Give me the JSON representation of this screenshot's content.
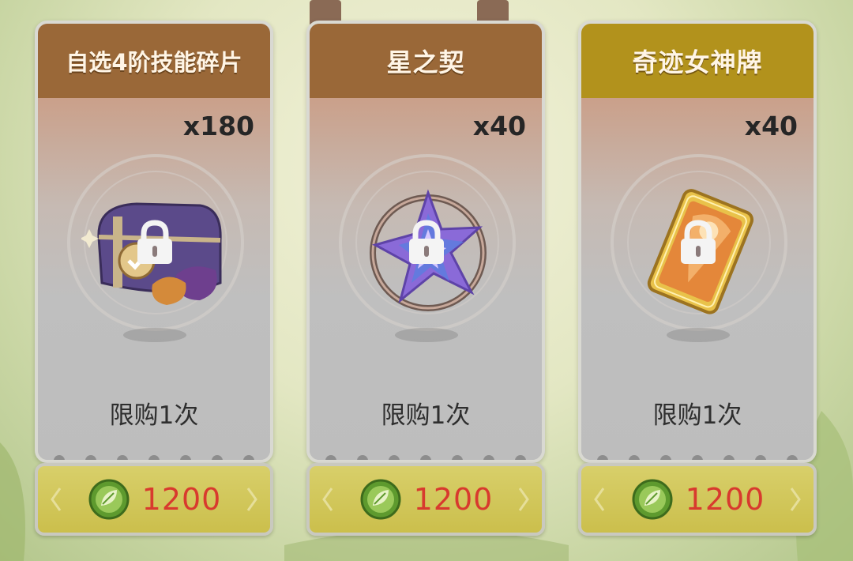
{
  "shop": {
    "cards": [
      {
        "title": "自选4阶技能碎片",
        "quantity": "x180",
        "limit": "限购1次",
        "price": "1200",
        "item_icon": "skill-fragment-chest-icon",
        "currency_icon": "leaf-coin-icon",
        "locked": true
      },
      {
        "title": "星之契",
        "quantity": "x40",
        "limit": "限购1次",
        "price": "1200",
        "item_icon": "star-contract-crystal-icon",
        "currency_icon": "leaf-coin-icon",
        "locked": true
      },
      {
        "title": "奇迹女神牌",
        "quantity": "x40",
        "limit": "限购1次",
        "price": "1200",
        "item_icon": "miracle-goddess-card-icon",
        "currency_icon": "leaf-coin-icon",
        "locked": true
      }
    ]
  },
  "colors": {
    "title_bar_brown": "#9a6838",
    "title_bar_gold": "#b2921c",
    "price_text": "#d83a2e",
    "price_button": "#cbbf4c"
  }
}
